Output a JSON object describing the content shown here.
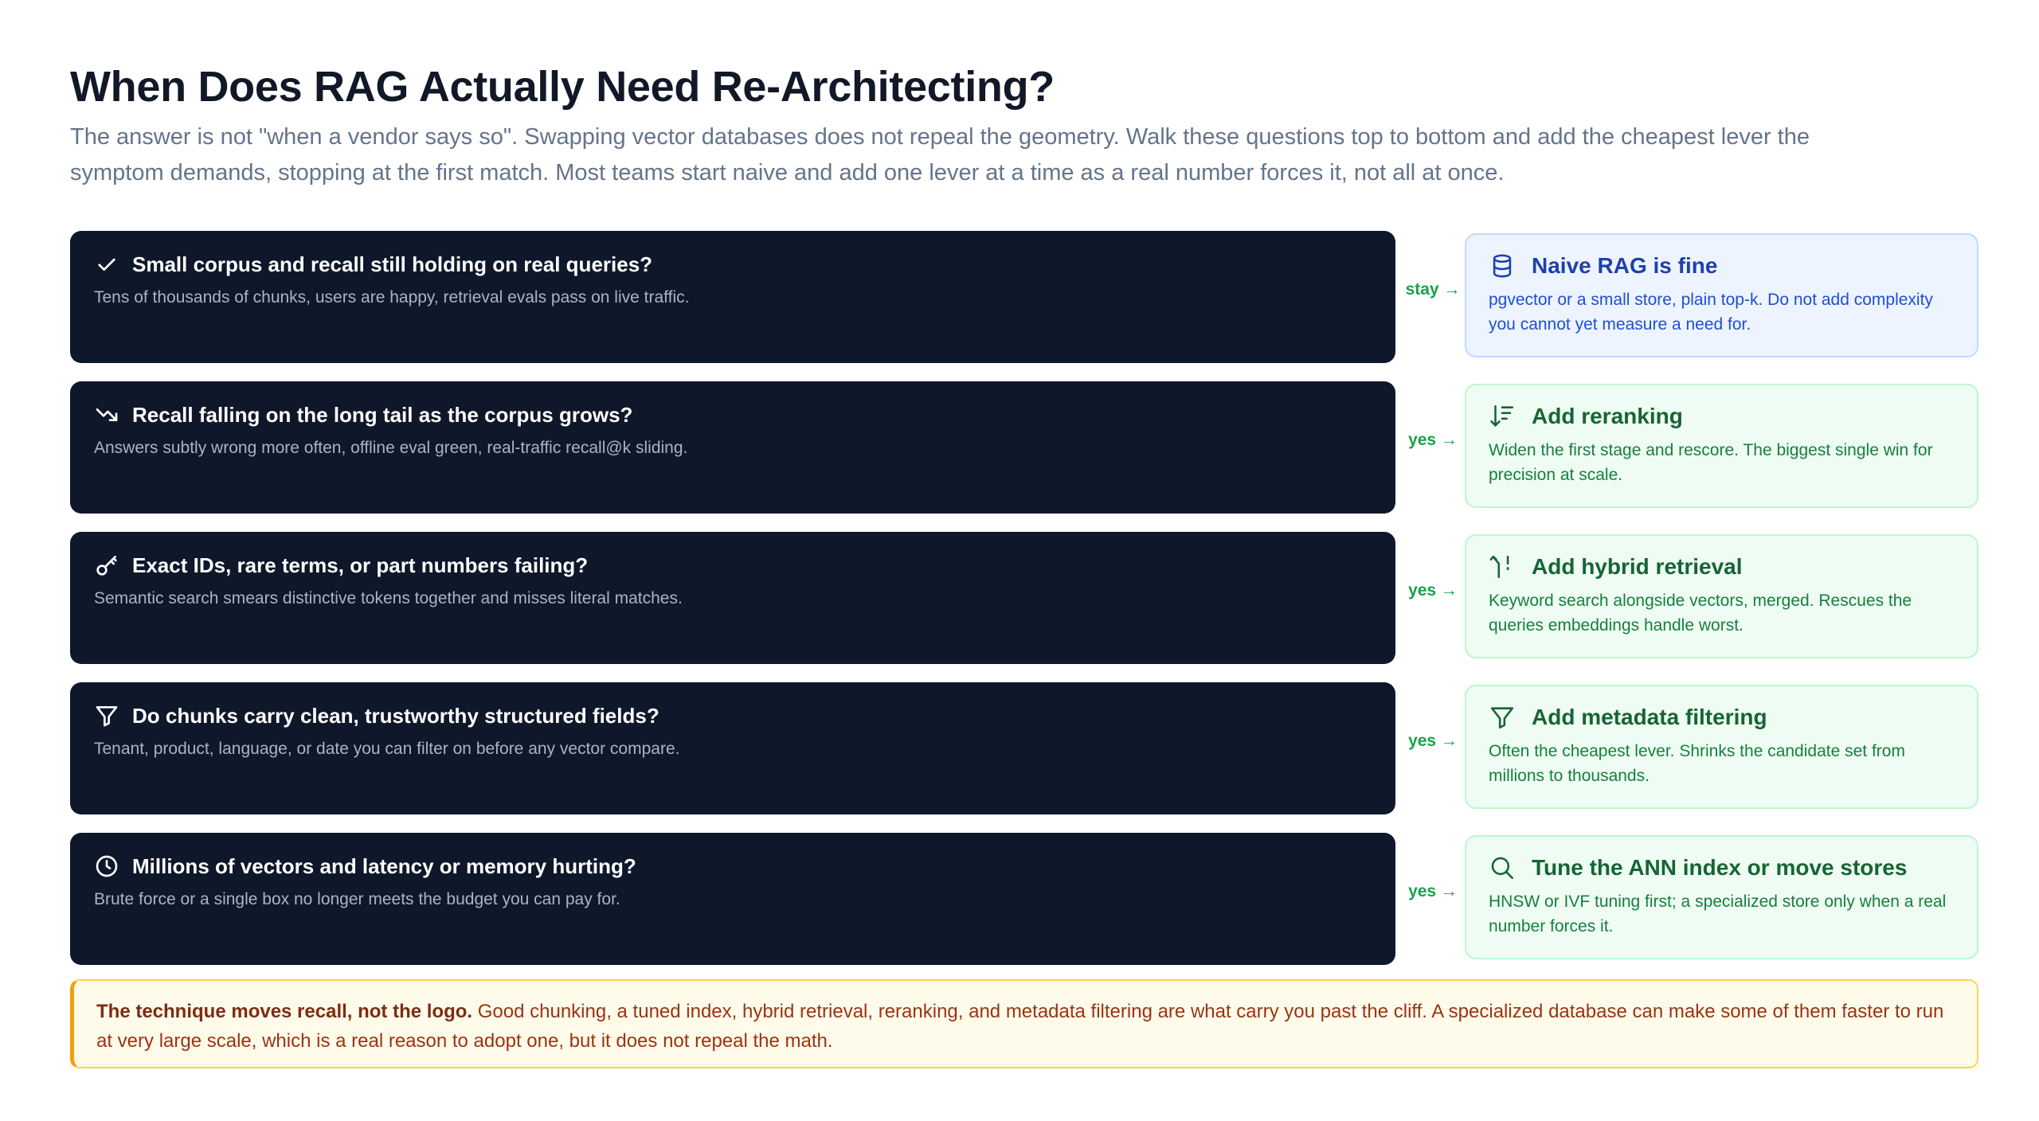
{
  "header": {
    "title": "When Does RAG Actually Need Re-Architecting?",
    "subtitle": "The answer is not \"when a vendor says so\". Swapping vector databases does not repeal the geometry. Walk these questions top to bottom and add the cheapest lever the symptom demands, stopping at the first match. Most teams start naive and add one lever at a time as a real number forces it, not all at once."
  },
  "rows": [
    {
      "question": "Small corpus and recall still holding on real queries?",
      "detail": "Tens of thousands of chunks, users are happy, retrieval evals pass on live traffic.",
      "question_icon": "check-icon",
      "arrow": "stay →",
      "answer_title": "Naive RAG is fine",
      "answer_desc": "pgvector or a small store, plain top-k. Do not add complexity you cannot yet measure a need for.",
      "answer_icon": "database-icon"
    },
    {
      "question": "Recall falling on the long tail as the corpus grows?",
      "detail": "Answers subtly wrong more often, offline eval green, real-traffic recall@k sliding.",
      "question_icon": "trending-down-icon",
      "arrow": "yes →",
      "answer_title": "Add reranking",
      "answer_desc": "Widen the first stage and rescore. The biggest single win for precision at scale.",
      "answer_icon": "sort-descending-icon"
    },
    {
      "question": "Exact IDs, rare terms, or part numbers failing?",
      "detail": "Semantic search smears distinctive tokens together and misses literal matches.",
      "question_icon": "key-icon",
      "arrow": "yes →",
      "answer_title": "Add hybrid retrieval",
      "answer_desc": "Keyword search alongside vectors, merged. Rescues the queries embeddings handle worst.",
      "answer_icon": "merge-icon"
    },
    {
      "question": "Do chunks carry clean, trustworthy structured fields?",
      "detail": "Tenant, product, language, or date you can filter on before any vector compare.",
      "question_icon": "filter-icon",
      "arrow": "yes →",
      "answer_title": "Add metadata filtering",
      "answer_desc": "Often the cheapest lever. Shrinks the candidate set from millions to thousands.",
      "answer_icon": "filter-icon"
    },
    {
      "question": "Millions of vectors and latency or memory hurting?",
      "detail": "Brute force or a single box no longer meets the budget you can pay for.",
      "question_icon": "clock-icon",
      "arrow": "yes →",
      "answer_title": "Tune the ANN index or move stores",
      "answer_desc": "HNSW or IVF tuning first; a specialized store only when a real number forces it.",
      "answer_icon": "search-icon"
    }
  ],
  "note": {
    "bold": "The technique moves recall, not the logo.",
    "text": " Good chunking, a tuned index, hybrid retrieval, reranking, and metadata filtering are what carry you past the cliff. A specialized database can make some of them faster to run at very large scale, which is a real reason to adopt one, but it does not repeal the math."
  },
  "colors": {
    "question_bg": "#0f172a",
    "answer_green_bg": "#effcf3",
    "answer_blue_bg": "#eef4ff",
    "arrow": "#16a34a",
    "note_bg": "#fffbeb",
    "note_accent": "#f59e0b"
  }
}
